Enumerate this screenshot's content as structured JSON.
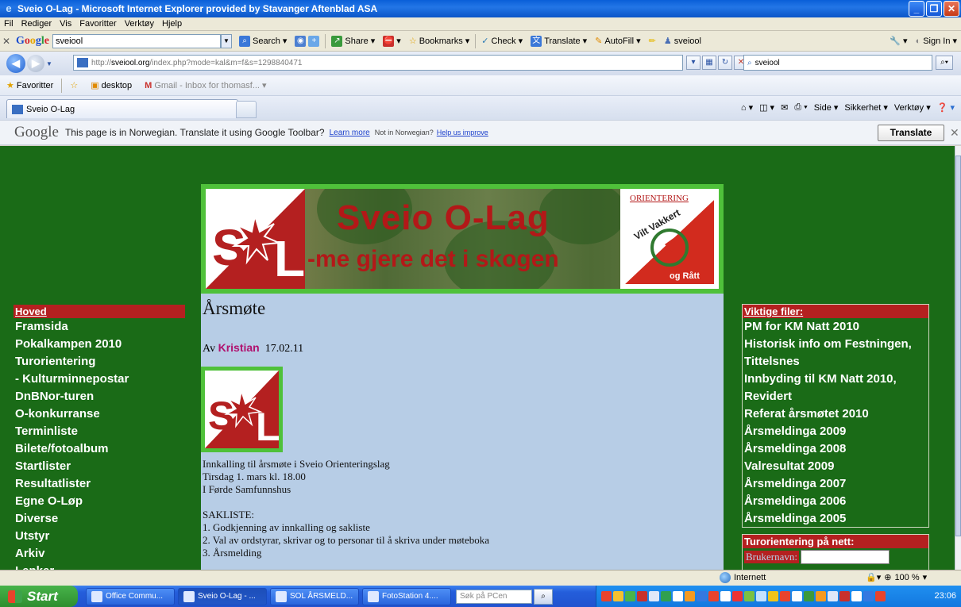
{
  "window": {
    "title": "Sveio O-Lag - Microsoft Internet Explorer provided by Stavanger Aftenblad ASA"
  },
  "menubar": [
    "Fil",
    "Rediger",
    "Vis",
    "Favoritter",
    "Verktøy",
    "Hjelp"
  ],
  "google_toolbar": {
    "logo": "Google",
    "search_value": "sveiool",
    "items": [
      "Search",
      "Share",
      "Bookmarks",
      "Check",
      "Translate",
      "AutoFill",
      "sveiool"
    ],
    "sign_in": "Sign In"
  },
  "address_bar": {
    "url_scheme": "http://",
    "url_host": "sveiool.org",
    "url_rest": "/index.php?mode=kal&m=f&s=1298840471",
    "live_search_value": "sveiool"
  },
  "favorites_bar": {
    "favorites_label": "Favoritter",
    "items": [
      "desktop",
      "Gmail - Inbox for thomasf..."
    ]
  },
  "tabs": [
    {
      "label": "Sveio O-Lag"
    }
  ],
  "command_bar": [
    "Side",
    "Sikkerhet",
    "Verktøy"
  ],
  "translate_bar": {
    "logo": "Google",
    "message": "This page is in Norwegian.  Translate it using Google Toolbar?",
    "learn_more": "Learn more",
    "not_in": "Not in Norwegian?",
    "help": "Help us improve",
    "button": "Translate"
  },
  "banner": {
    "title": "Sveio O-Lag",
    "subtitle": "-me gjere det i skogen",
    "logo_text": "S L",
    "badge_top": "ORIENTERING",
    "badge_mid": "Vilt Vakkert",
    "badge_bottom": "og Rått"
  },
  "article": {
    "title": "Årsmøte",
    "by_prefix": "Av",
    "author": "Kristian",
    "date": "17.02.11",
    "lines": [
      "Innkalling til årsmøte i Sveio Orienteringslag",
      "Tirsdag 1. mars kl. 18.00",
      "I Førde Samfunnshus",
      "",
      "SAKLISTE:",
      "1. Godkjenning av innkalling og sakliste",
      "2. Val av ordstyrar, skrivar og to personar til å skriva under møteboka",
      "3. Årsmelding"
    ]
  },
  "left_nav": {
    "header": "Hoved",
    "items": [
      "Framsida",
      "Pokalkampen 2010",
      "Turorientering",
      "- Kulturminnepostar",
      "DnBNor-turen",
      "O-konkurranse",
      "Terminliste",
      "Bilete/fotoalbum",
      "Startlister",
      "Resultatlister",
      "Egne O-Løp",
      "Diverse",
      "Utstyr",
      "Arkiv",
      "Lenker"
    ]
  },
  "right_files": {
    "header": "Viktige filer:",
    "items": [
      "PM for KM Natt 2010",
      "Historisk info om Festningen, Tittelsnes",
      "Innbyding til KM Natt 2010, Revidert",
      "Referat årsmøtet 2010",
      "Årsmeldinga 2009",
      "Årsmeldinga 2008",
      "Valresultat 2009",
      "Årsmeldinga 2007",
      "Årsmeldinga 2006",
      "Årsmeldinga 2005"
    ]
  },
  "turorientering": {
    "header": "Turorientering på nett:",
    "username_label": "Brukernavn:"
  },
  "status_bar": {
    "zone": "Internett",
    "zoom": "100 %"
  },
  "taskbar": {
    "start": "Start",
    "tasks": [
      "Office Commu...",
      "Sveio O-Lag - ...",
      "SOL ÅRSMELD...",
      "FotoStation 4...."
    ],
    "search_placeholder": "Søk på PCen",
    "clock": "23:06"
  },
  "colors": {
    "page_bg": "#1a6b17",
    "nav_header": "#b42020",
    "content_bg": "#b7cde6",
    "banner_red": "#b31818",
    "author": "#b0126f"
  }
}
